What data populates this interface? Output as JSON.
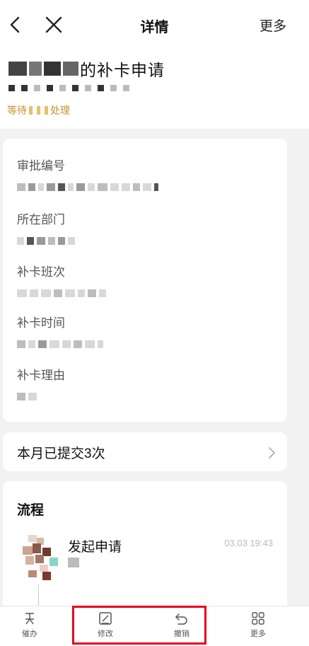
{
  "nav": {
    "title": "详情",
    "more": "更多"
  },
  "header": {
    "title_suffix": "的补卡申请",
    "status_prefix": "等待",
    "status_suffix": "处理",
    "status_color": "#c69228"
  },
  "details": {
    "fields": [
      {
        "label": "审批编号"
      },
      {
        "label": "所在部门"
      },
      {
        "label": "补卡班次"
      },
      {
        "label": "补卡时间"
      },
      {
        "label": "补卡理由"
      }
    ]
  },
  "month": {
    "text": "本月已提交3次"
  },
  "flow": {
    "title": "流程",
    "step": "发起申请",
    "time": "03.03 19:43"
  },
  "tabbar": {
    "items": [
      {
        "label": "催办",
        "icon": "urge-icon"
      },
      {
        "label": "修改",
        "icon": "edit-icon"
      },
      {
        "label": "撤销",
        "icon": "undo-icon"
      },
      {
        "label": "更多",
        "icon": "grid-icon"
      }
    ]
  },
  "highlight_color": "#e8001c"
}
